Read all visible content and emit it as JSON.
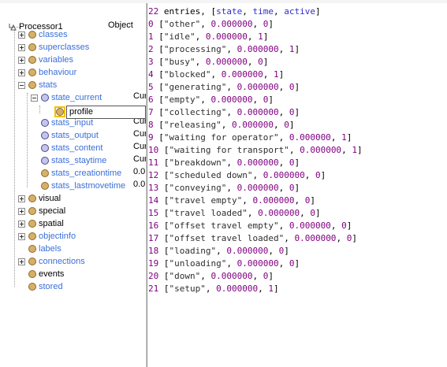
{
  "tree": {
    "root": {
      "label": "Processor1",
      "value": "Object"
    },
    "items": [
      {
        "label": "classes",
        "value": ""
      },
      {
        "label": "superclasses",
        "value": ""
      },
      {
        "label": "variables",
        "value": ""
      },
      {
        "label": "behaviour",
        "value": ""
      },
      {
        "label": "stats",
        "value": ""
      },
      {
        "label": "state_current",
        "value": "Cur"
      },
      {
        "label": "profile",
        "value": ""
      },
      {
        "label": "stats_input",
        "value": "Cur"
      },
      {
        "label": "stats_output",
        "value": "Cur"
      },
      {
        "label": "stats_content",
        "value": "Cur"
      },
      {
        "label": "stats_staytime",
        "value": "Cur"
      },
      {
        "label": "stats_creationtime",
        "value": "0.0"
      },
      {
        "label": "stats_lastmovetime",
        "value": "0.0"
      },
      {
        "label": "visual",
        "value": ""
      },
      {
        "label": "special",
        "value": ""
      },
      {
        "label": "spatial",
        "value": ""
      },
      {
        "label": "objectinfo",
        "value": ""
      },
      {
        "label": "labels",
        "value": ""
      },
      {
        "label": "connections",
        "value": ""
      },
      {
        "label": "events",
        "value": ""
      },
      {
        "label": "stored",
        "value": ""
      }
    ]
  },
  "output": {
    "header": {
      "count": "22",
      "text": " entries, [",
      "fields": [
        "state",
        "time",
        "active"
      ],
      "close": "]"
    },
    "entries": [
      {
        "i": "0",
        "s": "\"other\"",
        "t": "0.000000",
        "a": "0"
      },
      {
        "i": "1",
        "s": "\"idle\"",
        "t": "0.000000",
        "a": "1"
      },
      {
        "i": "2",
        "s": "\"processing\"",
        "t": "0.000000",
        "a": "1"
      },
      {
        "i": "3",
        "s": "\"busy\"",
        "t": "0.000000",
        "a": "0"
      },
      {
        "i": "4",
        "s": "\"blocked\"",
        "t": "0.000000",
        "a": "1"
      },
      {
        "i": "5",
        "s": "\"generating\"",
        "t": "0.000000",
        "a": "0"
      },
      {
        "i": "6",
        "s": "\"empty\"",
        "t": "0.000000",
        "a": "0"
      },
      {
        "i": "7",
        "s": "\"collecting\"",
        "t": "0.000000",
        "a": "0"
      },
      {
        "i": "8",
        "s": "\"releasing\"",
        "t": "0.000000",
        "a": "0"
      },
      {
        "i": "9",
        "s": "\"waiting for operator\"",
        "t": "0.000000",
        "a": "1"
      },
      {
        "i": "10",
        "s": "\"waiting for transport\"",
        "t": "0.000000",
        "a": "1"
      },
      {
        "i": "11",
        "s": "\"breakdown\"",
        "t": "0.000000",
        "a": "0"
      },
      {
        "i": "12",
        "s": "\"scheduled down\"",
        "t": "0.000000",
        "a": "0"
      },
      {
        "i": "13",
        "s": "\"conveying\"",
        "t": "0.000000",
        "a": "0"
      },
      {
        "i": "14",
        "s": "\"travel empty\"",
        "t": "0.000000",
        "a": "0"
      },
      {
        "i": "15",
        "s": "\"travel loaded\"",
        "t": "0.000000",
        "a": "0"
      },
      {
        "i": "16",
        "s": "\"offset travel empty\"",
        "t": "0.000000",
        "a": "0"
      },
      {
        "i": "17",
        "s": "\"offset travel loaded\"",
        "t": "0.000000",
        "a": "0"
      },
      {
        "i": "18",
        "s": "\"loading\"",
        "t": "0.000000",
        "a": "0"
      },
      {
        "i": "19",
        "s": "\"unloading\"",
        "t": "0.000000",
        "a": "0"
      },
      {
        "i": "20",
        "s": "\"down\"",
        "t": "0.000000",
        "a": "0"
      },
      {
        "i": "21",
        "s": "\"setup\"",
        "t": "0.000000",
        "a": "1"
      }
    ]
  },
  "colors": {
    "number": "#800080",
    "keyword": "#2d2dd0",
    "tree_link": "#3a6fd8",
    "selection": "#f2c200"
  }
}
